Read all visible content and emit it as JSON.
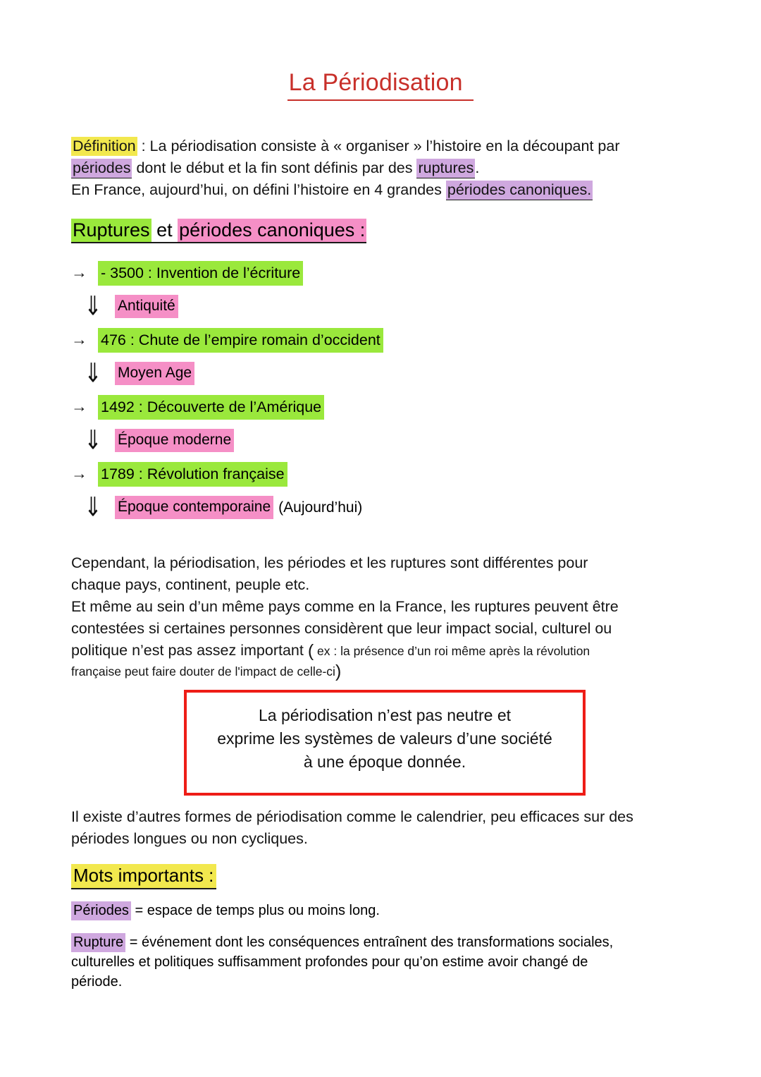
{
  "document": {
    "title": "La Périodisation "
  },
  "definition": {
    "term": "Définition",
    "line1_after_term": " : La périodisation consiste à « organiser » l’histoire en la découpant par",
    "line2_hl": "périodes",
    "line2_mid": " dont le début et la fin sont définis par des ",
    "line2_hl2": "ruptures",
    "line2_end": ".",
    "line3_start": "En France, aujourd’hui, on défini l’histoire en 4 grandes ",
    "line3_hl": "périodes canoniques."
  },
  "ruptures_section": {
    "heading_part1": "Ruptures",
    "heading_part2": " et ",
    "heading_part3": "périodes canoniques :",
    "arrow_right": "→",
    "arrow_down": "⇓",
    "events": [
      {
        "label": "- 3500 : Invention de l’écriture",
        "period": "Antiquité",
        "period_suffix": ""
      },
      {
        "label": "476 : Chute de l’empire romain d’occident",
        "period": "Moyen Age",
        "period_suffix": ""
      },
      {
        "label": "1492 : Découverte de l’Amérique",
        "period": "Époque moderne",
        "period_suffix": ""
      },
      {
        "label": "1789  : Révolution française",
        "period": "Époque contemporaine",
        "period_suffix": "(Aujourd’hui)"
      }
    ]
  },
  "paragraph_differences": {
    "line1": "Cependant, la périodisation, les périodes et les ruptures sont différentes pour",
    "line2": "chaque pays, continent, peuple etc.",
    "line3": "Et même au sein d’un même pays comme en la France, les ruptures peuvent être",
    "line4": "contestées si certaines personnes considèrent que leur impact social, culturel ou",
    "line5": "politique n’est pas assez important ",
    "paren_open": "(",
    "note_line1": " ex : la présence d’un roi même après la révolution",
    "note_line2": "française peut faire douter de l'impact de celle-ci",
    "paren_close": ")"
  },
  "callout": {
    "line1": "La périodisation n’est pas neutre et",
    "line2": "exprime les systèmes de valeurs d’une société",
    "line3": "à une époque donnée.",
    "border_color": "#ee1d17"
  },
  "paragraph_calendrier": {
    "line1": "Il existe d’autres formes de périodisation comme le calendrier, peu efficaces sur des",
    "line2": "périodes longues ou non cycliques."
  },
  "mots_importants": {
    "heading": "Mots importants :",
    "entries": [
      {
        "term": "Périodes",
        "definition_line1": " = espace de temps plus ou moins long.",
        "definition_line2": "",
        "definition_line3": ""
      },
      {
        "term": "Rupture",
        "definition_line1": " = événement dont les conséquences entraînent des transformations sociales,",
        "definition_line2": "culturelles et politiques suffisamment profondes pour qu’on estime avoir changé de",
        "definition_line3": "période."
      }
    ]
  },
  "colors": {
    "title_red": "#c8302a",
    "highlight_yellow": "#f2e84e",
    "highlight_purple": "#cfa8df",
    "highlight_green": "#9ae83c",
    "highlight_pink": "#f58fc6",
    "callout_red": "#ee1d17"
  }
}
